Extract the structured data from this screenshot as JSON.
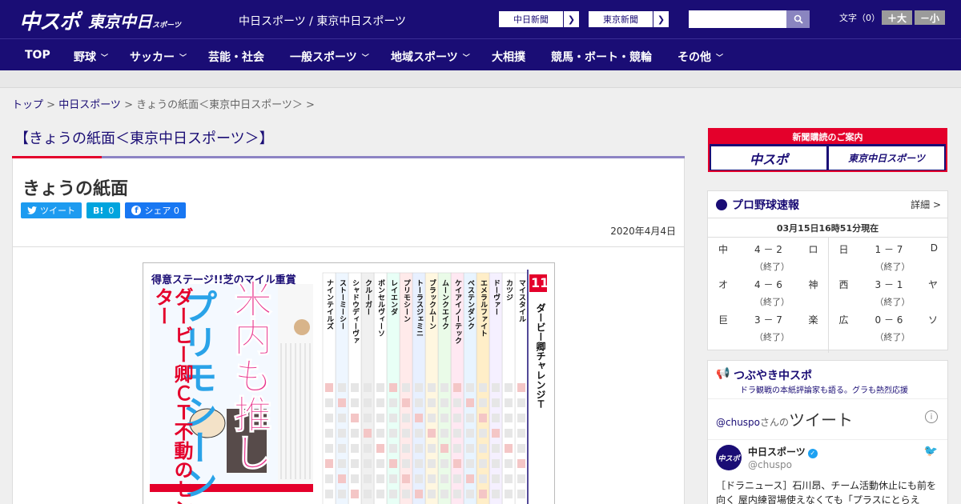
{
  "header": {
    "logo_main": "中スポ",
    "logo_tokyo": "東京中日",
    "logo_tokyo_small": "スポーツ",
    "site_name": "中日スポーツ / 東京中日スポーツ",
    "paper_buttons": [
      "中日新聞",
      "東京新聞"
    ],
    "search_placeholder": "",
    "font_label": "文字（0）",
    "font_larger": "＋大",
    "font_smaller": "－小"
  },
  "nav": {
    "items": [
      {
        "label": "TOP",
        "dropdown": false
      },
      {
        "label": "野球",
        "dropdown": true
      },
      {
        "label": "サッカー",
        "dropdown": true
      },
      {
        "label": "芸能・社会",
        "dropdown": false
      },
      {
        "label": "一般スポーツ",
        "dropdown": true
      },
      {
        "label": "地域スポーツ",
        "dropdown": true
      },
      {
        "label": "大相撲",
        "dropdown": false
      },
      {
        "label": "競馬・ボート・競輪",
        "dropdown": false
      },
      {
        "label": "その他",
        "dropdown": true
      }
    ]
  },
  "breadcrumb": {
    "top": "トップ",
    "sep": " > ",
    "section": "中日スポーツ",
    "current": "きょうの紙面＜東京中日スポーツ＞",
    "trail_sep": " >"
  },
  "page": {
    "heading": "【きょうの紙面＜東京中日スポーツ＞】",
    "title": "きょうの紙面",
    "tweet_label": "ツイート",
    "hatena_label": "B!",
    "hatena_count": "0",
    "share_label": "シェア",
    "share_count": "0",
    "date": "2020年4月4日"
  },
  "newspaper": {
    "top_left": "得意ステージ!!芝のマイル重賞",
    "headline_1": "米内も推し",
    "headline_2": "プリモシーン",
    "side": "ダービー卿ＣＴ不動のセンター",
    "race_no": "11",
    "race_name": "ダービー卿チャレンジＴ",
    "horses": [
      "マイスタイル",
      "カツジ",
      "ドーヴァー",
      "エメラルファイト",
      "ベステンダンク",
      "ケイアイノーテック",
      "ムーンクエイク",
      "ブラックムーン",
      "トーラスジェミニ",
      "プリモシーン",
      "レイエンダ",
      "ボンセルヴィーソ",
      "クルーガー",
      "シャドウディーヴァ",
      "ストーミーシー",
      "ナインテイルズ"
    ]
  },
  "colors": {
    "brand_navy": "#1a0d75",
    "accent_red": "#e4002b",
    "twitter": "#1d9bf0",
    "hatena": "#00a4de",
    "facebook": "#1877f2"
  },
  "subscription": {
    "banner": "新聞購読のご案内",
    "logo_chuspo": "中スポ",
    "logo_tokyo": "東京中日スポーツ"
  },
  "baseball": {
    "title": "プロ野球速報",
    "more": "詳細 >",
    "timestamp": "03月15日16時51分現在",
    "left_games": [
      {
        "home": "中",
        "score": "4 － 2",
        "away": "ロ",
        "status": "（終了）"
      },
      {
        "home": "オ",
        "score": "4 － 6",
        "away": "神",
        "status": "（終了）"
      },
      {
        "home": "巨",
        "score": "3 － 7",
        "away": "楽",
        "status": "（終了）"
      }
    ],
    "right_games": [
      {
        "home": "日",
        "score": "1 － 7",
        "away": "D",
        "status": "（終了）"
      },
      {
        "home": "西",
        "score": "3 － 1",
        "away": "ヤ",
        "status": "（終了）"
      },
      {
        "home": "広",
        "score": "0 － 6",
        "away": "ソ",
        "status": "（終了）"
      }
    ]
  },
  "twitter": {
    "title": "つぶやき中スポ",
    "subtitle": "ドラ観戦の本紙評論家も語る。グラも熱烈応援",
    "handle_link": "@chuspo",
    "handle_suffix": "さんの",
    "heading_word": "ツイート",
    "info_icon": "i",
    "account_name": "中日スポーツ",
    "account_handle": "@chuspo",
    "tweet_text": "［ドラニュース］石川昂、チーム活動休止にも前を向く 屋内練習場使えなくても「プラスにとらえ"
  }
}
